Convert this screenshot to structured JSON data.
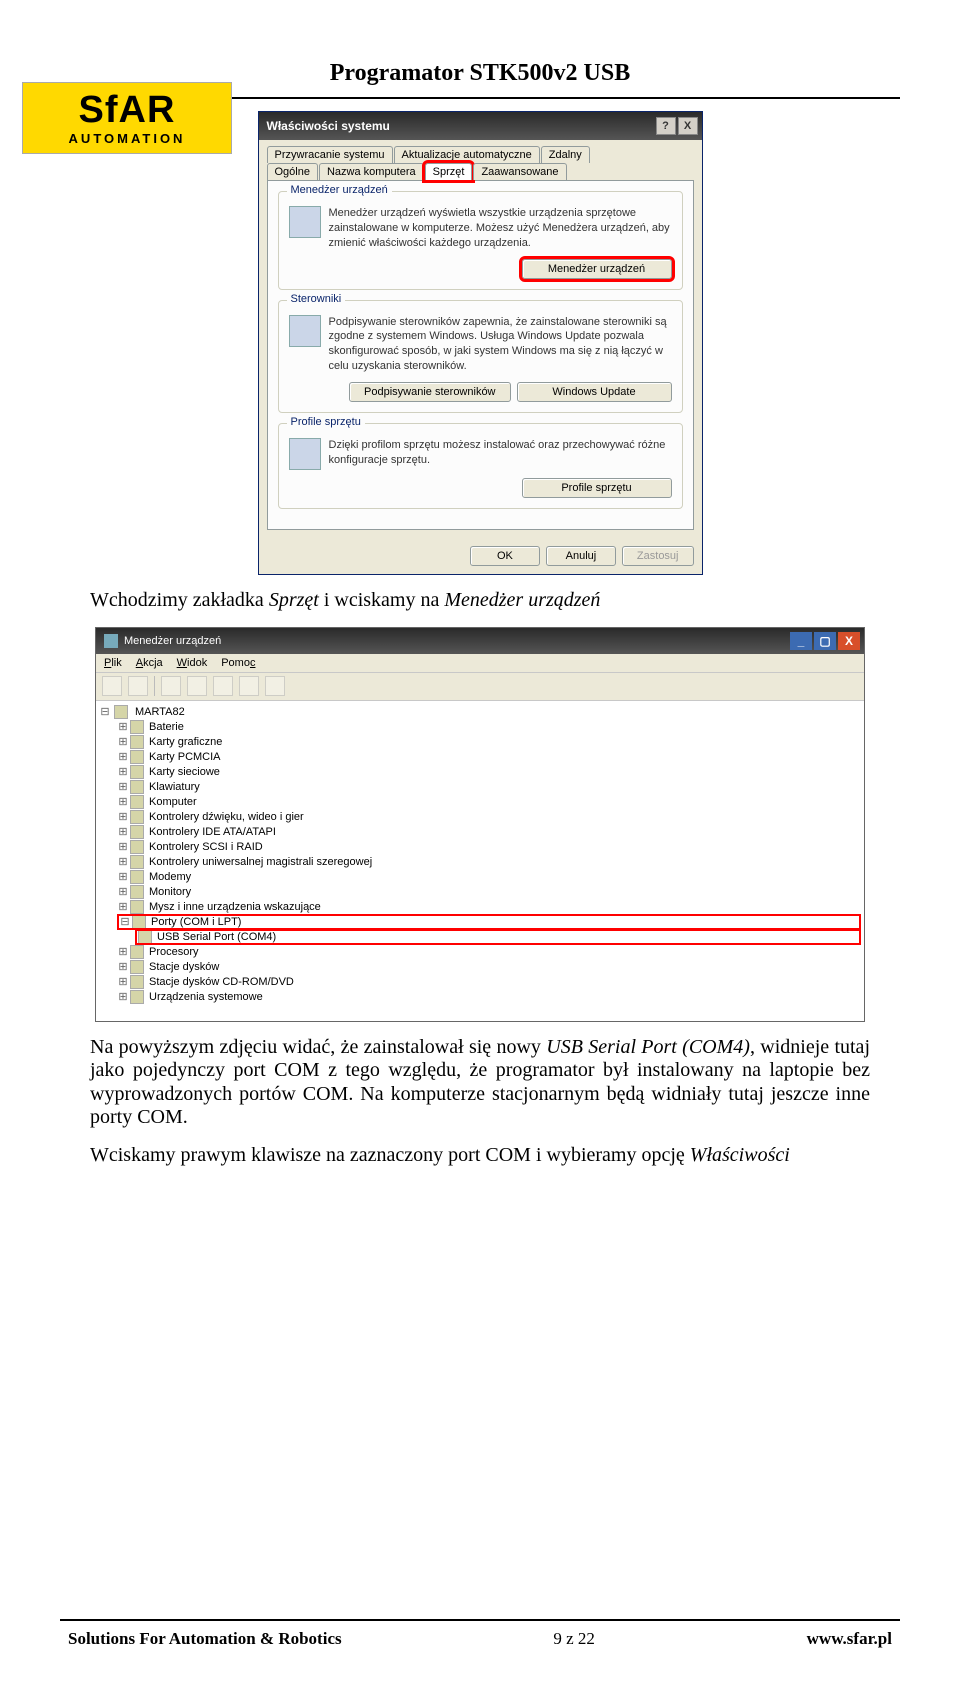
{
  "header": {
    "logo_main": "SfAR",
    "logo_sub": "AUTOMATION",
    "title": "Programator STK500v2 USB"
  },
  "dialog1": {
    "title": "Właściwości systemu",
    "help": "?",
    "close": "X",
    "tabs_row1": [
      "Przywracanie systemu",
      "Aktualizacje automatyczne",
      "Zdalny"
    ],
    "tabs_row2": [
      "Ogólne",
      "Nazwa komputera",
      "Sprzęt",
      "Zaawansowane"
    ],
    "group_devmgr": {
      "title": "Menedżer urządzeń",
      "text": "Menedżer urządzeń wyświetla wszystkie urządzenia sprzętowe zainstalowane w komputerze. Możesz użyć Menedżera urządzeń, aby zmienić właściwości każdego urządzenia.",
      "button": "Menedżer urządzeń"
    },
    "group_drivers": {
      "title": "Sterowniki",
      "text": "Podpisywanie sterowników zapewnia, że zainstalowane sterowniki są zgodne z systemem Windows. Usługa Windows Update pozwala skonfigurować sposób, w jaki system Windows ma się z nią łączyć w celu uzyskania sterowników.",
      "btn1": "Podpisywanie sterowników",
      "btn2": "Windows Update"
    },
    "group_profiles": {
      "title": "Profile sprzętu",
      "text": "Dzięki profilom sprzętu możesz instalować oraz przechowywać różne konfiguracje sprzętu.",
      "button": "Profile sprzętu"
    },
    "footer": {
      "ok": "OK",
      "cancel": "Anuluj",
      "apply": "Zastosuj"
    }
  },
  "text1_a": "Wchodzimy zakładka ",
  "text1_b": "Sprzęt",
  "text1_c": " i wciskamy na ",
  "text1_d": "Menedżer urządzeń",
  "devmgr": {
    "title": "Menedżer urządzeń",
    "menu": [
      "Plik",
      "Akcja",
      "Widok",
      "Pomoc"
    ],
    "root": "MARTA82",
    "nodes": [
      "Baterie",
      "Karty graficzne",
      "Karty PCMCIA",
      "Karty sieciowe",
      "Klawiatury",
      "Komputer",
      "Kontrolery dźwięku, wideo i gier",
      "Kontrolery IDE ATA/ATAPI",
      "Kontrolery SCSI i RAID",
      "Kontrolery uniwersalnej magistrali szeregowej",
      "Modemy",
      "Monitory",
      "Mysz i inne urządzenia wskazujące"
    ],
    "ports_node": "Porty (COM i LPT)",
    "ports_child": "USB Serial Port (COM4)",
    "nodes_after": [
      "Procesory",
      "Stacje dysków",
      "Stacje dysków CD-ROM/DVD",
      "Urządzenia systemowe"
    ]
  },
  "text2_a": "Na powyższym zdjęciu widać, że zainstalował się nowy ",
  "text2_b": "USB Serial Port (COM4)",
  "text2_c": ", widnieje tutaj jako pojedynczy port COM z tego względu, że programator był instalowany na laptopie bez wyprowadzonych portów COM. Na komputerze stacjonarnym będą widniały tutaj jeszcze inne porty COM.",
  "text3_a": "Wciskamy prawym klawisze na zaznaczony port COM i wybieramy opcję ",
  "text3_b": "Właściwości",
  "footer": {
    "left": "Solutions For Automation & Robotics",
    "center": "9 z 22",
    "right": "www.sfar.pl"
  }
}
